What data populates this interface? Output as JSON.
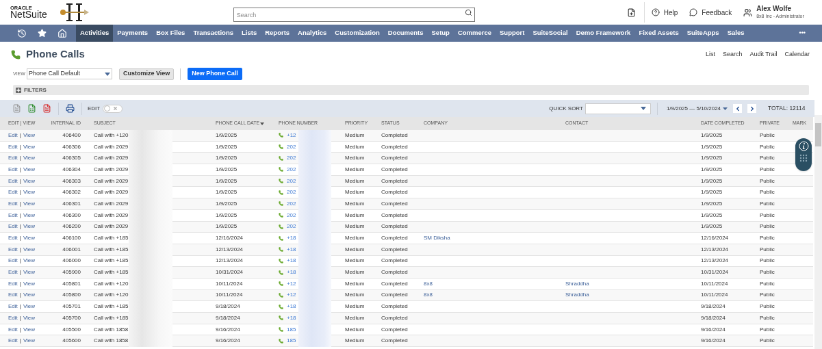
{
  "header": {
    "logo_top": "ORACLE",
    "logo_bottom": "NetSuite",
    "search": {
      "placeholder": "Search"
    },
    "help": "Help",
    "feedback": "Feedback",
    "user": {
      "name": "Alex Wolfe",
      "role": "8x8 Inc - Administrator"
    }
  },
  "nav": {
    "items": [
      {
        "label": "Activities",
        "selected": true
      },
      {
        "label": "Payments",
        "selected": false
      },
      {
        "label": "Box Files",
        "selected": false
      },
      {
        "label": "Transactions",
        "selected": false
      },
      {
        "label": "Lists",
        "selected": false
      },
      {
        "label": "Reports",
        "selected": false
      },
      {
        "label": "Analytics",
        "selected": false
      },
      {
        "label": "Customization",
        "selected": false
      },
      {
        "label": "Documents",
        "selected": false
      },
      {
        "label": "Setup",
        "selected": false
      },
      {
        "label": "Commerce",
        "selected": false
      },
      {
        "label": "Support",
        "selected": false
      },
      {
        "label": "SuiteSocial",
        "selected": false
      },
      {
        "label": "Demo Framework",
        "selected": false
      },
      {
        "label": "Fixed Assets",
        "selected": false
      },
      {
        "label": "SuiteApps",
        "selected": false
      },
      {
        "label": "Sales",
        "selected": false
      }
    ],
    "more": "•••"
  },
  "page": {
    "title": "Phone Calls",
    "links": [
      "List",
      "Search",
      "Audit Trail",
      "Calendar"
    ],
    "view_label": "VIEW",
    "view_value": "Phone Call Default",
    "customize_button": "Customize View",
    "new_button": "New Phone Call",
    "filters": "FILTERS"
  },
  "toolbar": {
    "edit_toggle": {
      "label": "EDIT",
      "on": false
    },
    "quick_sort_label": "QUICK SORT",
    "date_range": "1/9/2025 — 5/10/2024",
    "total": "TOTAL: 12114"
  },
  "table": {
    "columns": [
      {
        "label": "EDIT | VIEW",
        "sorted": false
      },
      {
        "label": "INTERNAL ID",
        "sorted": false
      },
      {
        "label": "SUBJECT",
        "sorted": false
      },
      {
        "label": "PHONE CALL DATE",
        "sorted": true
      },
      {
        "label": "PHONE NUMBER",
        "sorted": false
      },
      {
        "label": "PRIORITY",
        "sorted": false
      },
      {
        "label": "STATUS",
        "sorted": false
      },
      {
        "label": "COMPANY",
        "sorted": false
      },
      {
        "label": "CONTACT",
        "sorted": false
      },
      {
        "label": "DATE COMPLETED",
        "sorted": false
      },
      {
        "label": "PRIVATE",
        "sorted": false
      },
      {
        "label": "MARK",
        "sorted": false
      }
    ],
    "rows": [
      {
        "edit": "Edit",
        "sep": "|",
        "view": "View",
        "id": "406400",
        "subject": "Call with +120",
        "date": "1/9/2025",
        "phone": "+12",
        "priority": "Medium",
        "status": "Completed",
        "date_completed": "1/9/2025",
        "private": "Public"
      },
      {
        "edit": "Edit",
        "sep": "|",
        "view": "View",
        "id": "406306",
        "subject": "Call with 2029",
        "date": "1/9/2025",
        "phone": "202",
        "priority": "Medium",
        "status": "Completed",
        "date_completed": "1/9/2025",
        "private": "Public"
      },
      {
        "edit": "Edit",
        "sep": "|",
        "view": "View",
        "id": "406305",
        "subject": "Call with 2029",
        "date": "1/9/2025",
        "phone": "202",
        "priority": "Medium",
        "status": "Completed",
        "date_completed": "1/9/2025",
        "private": "Public"
      },
      {
        "edit": "Edit",
        "sep": "|",
        "view": "View",
        "id": "406304",
        "subject": "Call with 2029",
        "date": "1/9/2025",
        "phone": "202",
        "priority": "Medium",
        "status": "Completed",
        "date_completed": "1/9/2025",
        "private": "Public"
      },
      {
        "edit": "Edit",
        "sep": "|",
        "view": "View",
        "id": "406303",
        "subject": "Call with 2029",
        "date": "1/9/2025",
        "phone": "202",
        "priority": "Medium",
        "status": "Completed",
        "date_completed": "1/9/2025",
        "private": "Public"
      },
      {
        "edit": "Edit",
        "sep": "|",
        "view": "View",
        "id": "406302",
        "subject": "Call with 2029",
        "date": "1/9/2025",
        "phone": "202",
        "priority": "Medium",
        "status": "Completed",
        "date_completed": "1/9/2025",
        "private": "Public"
      },
      {
        "edit": "Edit",
        "sep": "|",
        "view": "View",
        "id": "406301",
        "subject": "Call with 2029",
        "date": "1/9/2025",
        "phone": "202",
        "priority": "Medium",
        "status": "Completed",
        "date_completed": "1/9/2025",
        "private": "Public"
      },
      {
        "edit": "Edit",
        "sep": "|",
        "view": "View",
        "id": "406300",
        "subject": "Call with 2029",
        "date": "1/9/2025",
        "phone": "202",
        "priority": "Medium",
        "status": "Completed",
        "date_completed": "1/9/2025",
        "private": "Public"
      },
      {
        "edit": "Edit",
        "sep": "|",
        "view": "View",
        "id": "406200",
        "subject": "Call with 2029",
        "date": "1/9/2025",
        "phone": "202",
        "priority": "Medium",
        "status": "Completed",
        "date_completed": "1/9/2025",
        "private": "Public"
      },
      {
        "edit": "Edit",
        "sep": "|",
        "view": "View",
        "id": "406100",
        "subject": "Call with +185",
        "date": "12/16/2024",
        "phone": "+18",
        "priority": "Medium",
        "status": "Completed",
        "company": "SM Diksha",
        "date_completed": "12/16/2024",
        "private": "Public"
      },
      {
        "edit": "Edit",
        "sep": "|",
        "view": "View",
        "id": "406001",
        "subject": "Call with +185",
        "date": "12/13/2024",
        "phone": "+18",
        "priority": "Medium",
        "status": "Completed",
        "date_completed": "12/13/2024",
        "private": "Public"
      },
      {
        "edit": "Edit",
        "sep": "|",
        "view": "View",
        "id": "406000",
        "subject": "Call with +185",
        "date": "12/13/2024",
        "phone": "+18",
        "priority": "Medium",
        "status": "Completed",
        "date_completed": "12/13/2024",
        "private": "Public"
      },
      {
        "edit": "Edit",
        "sep": "|",
        "view": "View",
        "id": "405900",
        "subject": "Call with +185",
        "date": "10/31/2024",
        "phone": "+18",
        "priority": "Medium",
        "status": "Completed",
        "date_completed": "10/31/2024",
        "private": "Public"
      },
      {
        "edit": "Edit",
        "sep": "|",
        "view": "View",
        "id": "405801",
        "subject": "Call with +120",
        "date": "10/11/2024",
        "phone": "+12",
        "priority": "Medium",
        "status": "Completed",
        "company": "8x8",
        "contact": "Shraddha",
        "date_completed": "10/11/2024",
        "private": "Public"
      },
      {
        "edit": "Edit",
        "sep": "|",
        "view": "View",
        "id": "405800",
        "subject": "Call with +120",
        "date": "10/11/2024",
        "phone": "+12",
        "priority": "Medium",
        "status": "Completed",
        "company": "8x8",
        "contact": "Shraddha",
        "date_completed": "10/11/2024",
        "private": "Public"
      },
      {
        "edit": "Edit",
        "sep": "|",
        "view": "View",
        "id": "405701",
        "subject": "Call with +185",
        "date": "9/18/2024",
        "phone": "+18",
        "priority": "Medium",
        "status": "Completed",
        "date_completed": "9/18/2024",
        "private": "Public"
      },
      {
        "edit": "Edit",
        "sep": "|",
        "view": "View",
        "id": "405700",
        "subject": "Call with +185",
        "date": "9/18/2024",
        "phone": "+18",
        "priority": "Medium",
        "status": "Completed",
        "date_completed": "9/18/2024",
        "private": "Public"
      },
      {
        "edit": "Edit",
        "sep": "|",
        "view": "View",
        "id": "405500",
        "subject": "Call with 1858",
        "date": "9/16/2024",
        "phone": "185",
        "priority": "Medium",
        "status": "Completed",
        "date_completed": "9/16/2024",
        "private": "Public"
      },
      {
        "edit": "Edit",
        "sep": "|",
        "view": "View",
        "id": "405600",
        "subject": "Call with 1858",
        "date": "9/16/2024",
        "phone": "185",
        "priority": "Medium",
        "status": "Completed",
        "date_completed": "9/16/2024",
        "private": "Public"
      }
    ]
  }
}
